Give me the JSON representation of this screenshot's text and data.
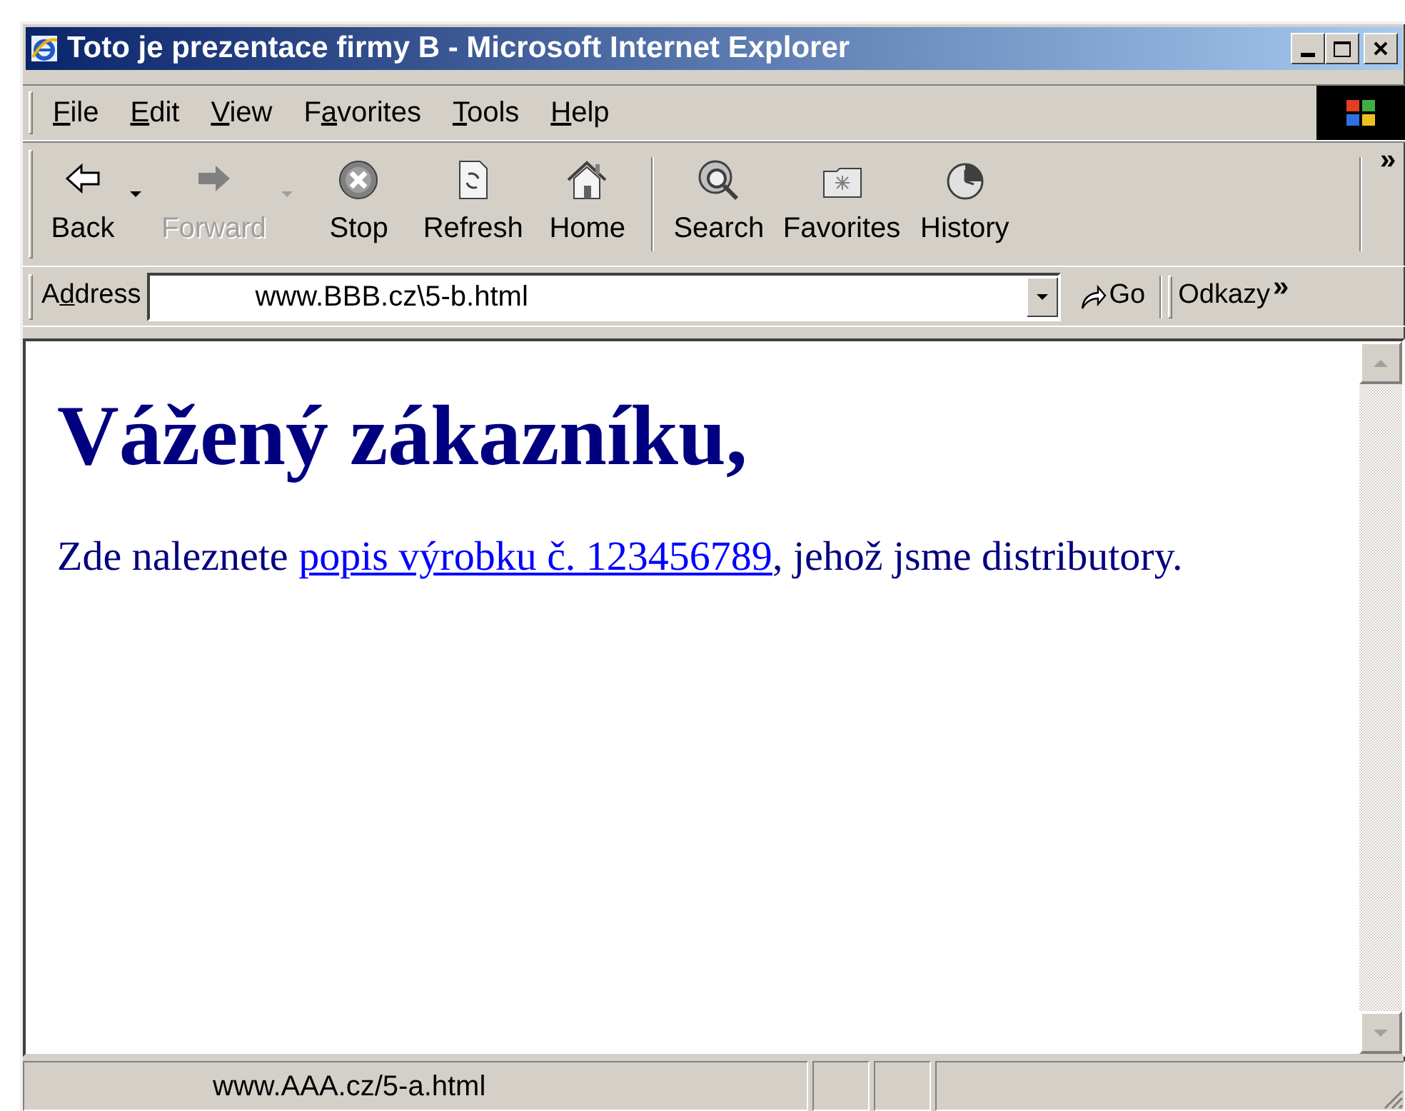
{
  "window": {
    "title": "Toto je prezentace firmy B - Microsoft Internet Explorer"
  },
  "menu": [
    {
      "key": "F",
      "post": "ile"
    },
    {
      "key": "E",
      "post": "dit"
    },
    {
      "key": "V",
      "post": "iew"
    },
    {
      "pre": "F",
      "key": "a",
      "post": "vorites"
    },
    {
      "key": "T",
      "post": "ools"
    },
    {
      "key": "H",
      "post": "elp"
    }
  ],
  "toolbar": {
    "groups": [
      [
        {
          "label": "Back",
          "disabled": false,
          "dropdown": true
        },
        {
          "label": "Forward",
          "disabled": true,
          "dropdown": true
        },
        {
          "label": "Stop",
          "disabled": false,
          "dropdown": false
        },
        {
          "label": "Refresh",
          "disabled": false,
          "dropdown": false
        },
        {
          "label": "Home",
          "disabled": false,
          "dropdown": false
        }
      ],
      [
        {
          "label": "Search",
          "disabled": false,
          "dropdown": false
        },
        {
          "label": "Favorites",
          "disabled": false,
          "dropdown": false
        },
        {
          "label": "History",
          "disabled": false,
          "dropdown": false
        }
      ]
    ],
    "more": "»"
  },
  "address_bar": {
    "label": {
      "pre": "A",
      "key": "d",
      "post": "dress"
    },
    "value": "www.BBB.cz\\5-b.html",
    "go": "Go",
    "links": "Odkazy",
    "more": "»"
  },
  "page": {
    "heading": "Vážený zákazníku,",
    "paragraph": [
      {
        "kind": "text",
        "text": "Zde naleznete "
      },
      {
        "kind": "link",
        "text": "popis výrobku č. 123456789"
      },
      {
        "kind": "text",
        "text": ", jehož jsme distributory."
      }
    ]
  },
  "status_bar": {
    "text": "www.AAA.cz/5-a.html"
  }
}
